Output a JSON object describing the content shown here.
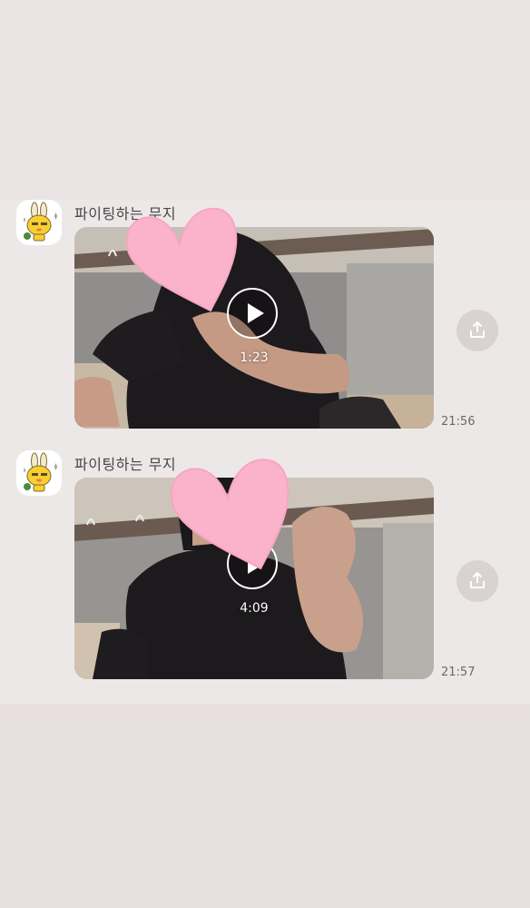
{
  "messages": [
    {
      "sender": "파이팅하는 무지",
      "avatar_icon": "rabbit-character-icon",
      "video_duration": "1:23",
      "time": "21:56"
    },
    {
      "sender": "파이팅하는 무지",
      "avatar_icon": "rabbit-character-icon",
      "video_duration": "4:09",
      "time": "21:57"
    }
  ],
  "icons": {
    "play": "play-icon",
    "share": "share-icon",
    "overlay": "heart-sticker-icon"
  },
  "colors": {
    "background": "#ede8e8",
    "heart": "#fbb3cc",
    "share_bg": "#d8d2d3"
  }
}
